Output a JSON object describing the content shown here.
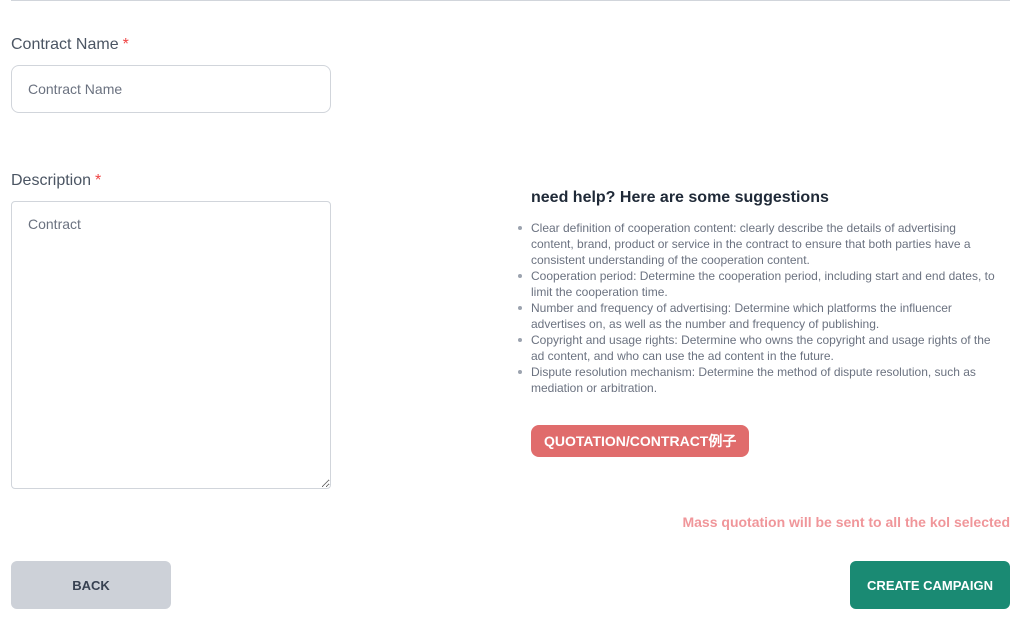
{
  "form": {
    "contract_name": {
      "label": "Contract Name",
      "required_mark": "*",
      "placeholder": "Contract Name",
      "value": ""
    },
    "description": {
      "label": "Description",
      "required_mark": "*",
      "placeholder": "Contract",
      "value": ""
    }
  },
  "help": {
    "title": "need help? Here are some suggestions",
    "items": [
      "Clear definition of cooperation content: clearly describe the details of advertising content, brand, product or service in the contract to ensure that both parties have a consistent understanding of the cooperation content.",
      "Cooperation period: Determine the cooperation period, including start and end dates, to limit the cooperation time.",
      "Number and frequency of advertising: Determine which platforms the influencer advertises on, as well as the number and frequency of publishing.",
      "Copyright and usage rights: Determine who owns the copyright and usage rights of the ad content, and who can use the ad content in the future.",
      "Dispute resolution mechanism: Determine the method of dispute resolution, such as mediation or arbitration."
    ],
    "example_button_label": "QUOTATION/CONTRACT例子"
  },
  "notice": "Mass quotation will be sent to all the kol selected",
  "actions": {
    "back_label": "BACK",
    "create_label": "CREATE CAMPAIGN"
  },
  "colors": {
    "primary": "#1a8a73",
    "example_button": "#e06c6c",
    "notice": "#f0969a",
    "required": "#ef4444",
    "back_button": "#cdd1d8"
  }
}
